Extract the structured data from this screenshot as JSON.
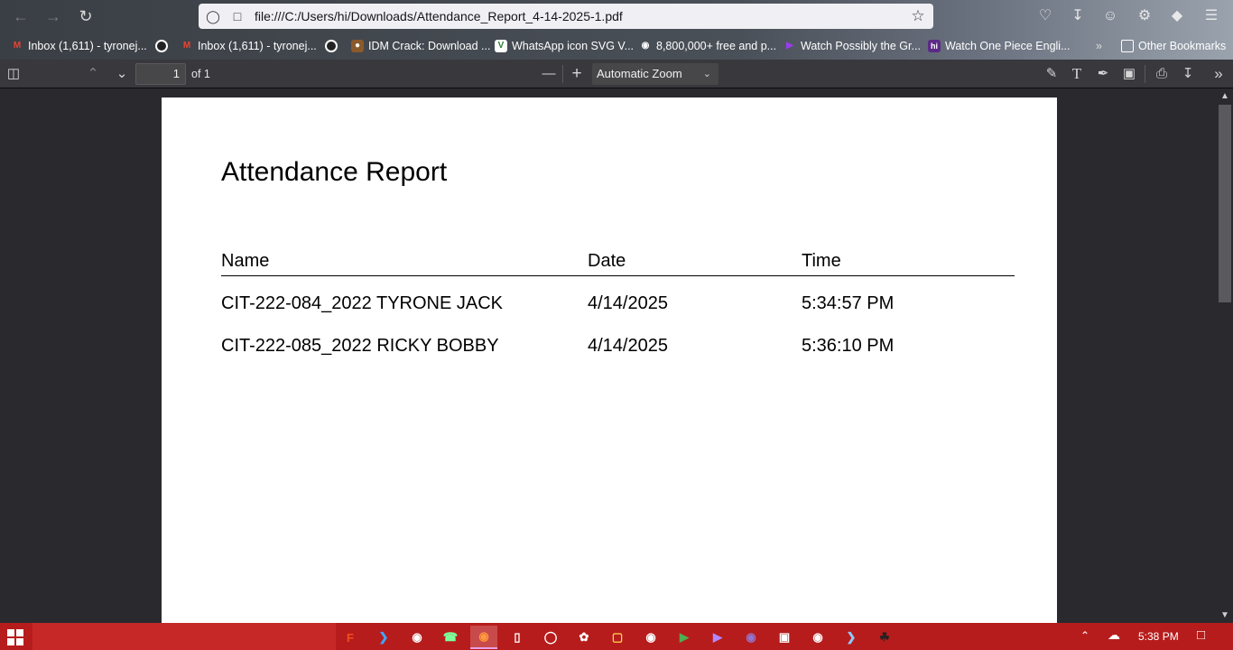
{
  "browser": {
    "url": "file:///C:/Users/hi/Downloads/Attendance_Report_4-14-2025-1.pdf",
    "bookmarks": [
      {
        "label": "Inbox (1,611) - tyronej...",
        "icon": "gmail-icon",
        "color": "#ea4335"
      },
      {
        "label": "",
        "icon": "obs-icon",
        "color": "#222222"
      },
      {
        "label": "Inbox (1,611) - tyronej...",
        "icon": "gmail-icon",
        "color": "#ea4335"
      },
      {
        "label": "",
        "icon": "obs-icon",
        "color": "#222222"
      },
      {
        "label": "IDM Crack: Download ...",
        "icon": "idm-icon",
        "color": "#8b5a2b"
      },
      {
        "label": "WhatsApp icon SVG V...",
        "icon": "svgrepo-icon",
        "color": "#2e7d32"
      },
      {
        "label": "8,800,000+ free and p...",
        "icon": "eye-icon",
        "color": "#333333"
      },
      {
        "label": "Watch Possibly the Gr...",
        "icon": "play-icon",
        "color": "#7b2cbf"
      },
      {
        "label": "Watch One Piece Engli...",
        "icon": "hi-icon",
        "color": "#5b2a86"
      },
      {
        "label": "Other Bookmarks",
        "icon": "folder-icon",
        "color": "#ffffff"
      }
    ]
  },
  "pdf_toolbar": {
    "page_number": "1",
    "page_count_label": "of 1",
    "zoom": "Automatic Zoom"
  },
  "document": {
    "title": "Attendance Report",
    "columns": [
      "Name",
      "Date",
      "Time"
    ],
    "rows": [
      [
        "CIT-222-084_2022 TYRONE JACK",
        "4/14/2025",
        "5:34:57 PM"
      ],
      [
        "CIT-222-085_2022 RICKY BOBBY",
        "4/14/2025",
        "5:36:10 PM"
      ]
    ]
  },
  "taskbar": {
    "clock": "5:38 PM",
    "apps": [
      "figma",
      "vscode",
      "github",
      "whatsapp",
      "firefox",
      "notepad",
      "obs",
      "chatgpt",
      "file-explorer",
      "chrome",
      "google-play",
      "video-player",
      "tor",
      "vm",
      "chrome",
      "terminal",
      "game"
    ]
  }
}
